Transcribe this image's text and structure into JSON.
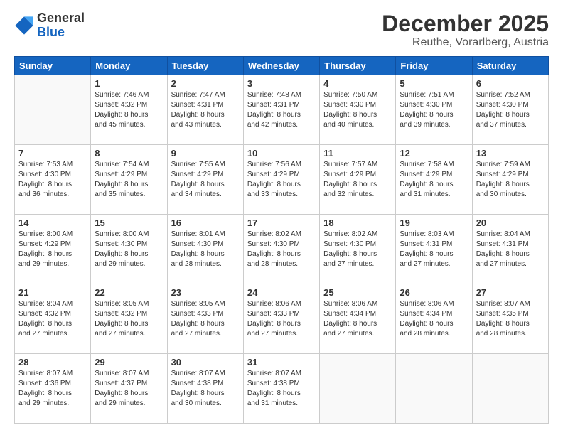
{
  "header": {
    "logo_line1": "General",
    "logo_line2": "Blue",
    "title": "December 2025",
    "subtitle": "Reuthe, Vorarlberg, Austria"
  },
  "days_of_week": [
    "Sunday",
    "Monday",
    "Tuesday",
    "Wednesday",
    "Thursday",
    "Friday",
    "Saturday"
  ],
  "weeks": [
    [
      {
        "day": "",
        "info": ""
      },
      {
        "day": "1",
        "info": "Sunrise: 7:46 AM\nSunset: 4:32 PM\nDaylight: 8 hours\nand 45 minutes."
      },
      {
        "day": "2",
        "info": "Sunrise: 7:47 AM\nSunset: 4:31 PM\nDaylight: 8 hours\nand 43 minutes."
      },
      {
        "day": "3",
        "info": "Sunrise: 7:48 AM\nSunset: 4:31 PM\nDaylight: 8 hours\nand 42 minutes."
      },
      {
        "day": "4",
        "info": "Sunrise: 7:50 AM\nSunset: 4:30 PM\nDaylight: 8 hours\nand 40 minutes."
      },
      {
        "day": "5",
        "info": "Sunrise: 7:51 AM\nSunset: 4:30 PM\nDaylight: 8 hours\nand 39 minutes."
      },
      {
        "day": "6",
        "info": "Sunrise: 7:52 AM\nSunset: 4:30 PM\nDaylight: 8 hours\nand 37 minutes."
      }
    ],
    [
      {
        "day": "7",
        "info": "Sunrise: 7:53 AM\nSunset: 4:30 PM\nDaylight: 8 hours\nand 36 minutes."
      },
      {
        "day": "8",
        "info": "Sunrise: 7:54 AM\nSunset: 4:29 PM\nDaylight: 8 hours\nand 35 minutes."
      },
      {
        "day": "9",
        "info": "Sunrise: 7:55 AM\nSunset: 4:29 PM\nDaylight: 8 hours\nand 34 minutes."
      },
      {
        "day": "10",
        "info": "Sunrise: 7:56 AM\nSunset: 4:29 PM\nDaylight: 8 hours\nand 33 minutes."
      },
      {
        "day": "11",
        "info": "Sunrise: 7:57 AM\nSunset: 4:29 PM\nDaylight: 8 hours\nand 32 minutes."
      },
      {
        "day": "12",
        "info": "Sunrise: 7:58 AM\nSunset: 4:29 PM\nDaylight: 8 hours\nand 31 minutes."
      },
      {
        "day": "13",
        "info": "Sunrise: 7:59 AM\nSunset: 4:29 PM\nDaylight: 8 hours\nand 30 minutes."
      }
    ],
    [
      {
        "day": "14",
        "info": "Sunrise: 8:00 AM\nSunset: 4:29 PM\nDaylight: 8 hours\nand 29 minutes."
      },
      {
        "day": "15",
        "info": "Sunrise: 8:00 AM\nSunset: 4:30 PM\nDaylight: 8 hours\nand 29 minutes."
      },
      {
        "day": "16",
        "info": "Sunrise: 8:01 AM\nSunset: 4:30 PM\nDaylight: 8 hours\nand 28 minutes."
      },
      {
        "day": "17",
        "info": "Sunrise: 8:02 AM\nSunset: 4:30 PM\nDaylight: 8 hours\nand 28 minutes."
      },
      {
        "day": "18",
        "info": "Sunrise: 8:02 AM\nSunset: 4:30 PM\nDaylight: 8 hours\nand 27 minutes."
      },
      {
        "day": "19",
        "info": "Sunrise: 8:03 AM\nSunset: 4:31 PM\nDaylight: 8 hours\nand 27 minutes."
      },
      {
        "day": "20",
        "info": "Sunrise: 8:04 AM\nSunset: 4:31 PM\nDaylight: 8 hours\nand 27 minutes."
      }
    ],
    [
      {
        "day": "21",
        "info": "Sunrise: 8:04 AM\nSunset: 4:32 PM\nDaylight: 8 hours\nand 27 minutes."
      },
      {
        "day": "22",
        "info": "Sunrise: 8:05 AM\nSunset: 4:32 PM\nDaylight: 8 hours\nand 27 minutes."
      },
      {
        "day": "23",
        "info": "Sunrise: 8:05 AM\nSunset: 4:33 PM\nDaylight: 8 hours\nand 27 minutes."
      },
      {
        "day": "24",
        "info": "Sunrise: 8:06 AM\nSunset: 4:33 PM\nDaylight: 8 hours\nand 27 minutes."
      },
      {
        "day": "25",
        "info": "Sunrise: 8:06 AM\nSunset: 4:34 PM\nDaylight: 8 hours\nand 27 minutes."
      },
      {
        "day": "26",
        "info": "Sunrise: 8:06 AM\nSunset: 4:34 PM\nDaylight: 8 hours\nand 28 minutes."
      },
      {
        "day": "27",
        "info": "Sunrise: 8:07 AM\nSunset: 4:35 PM\nDaylight: 8 hours\nand 28 minutes."
      }
    ],
    [
      {
        "day": "28",
        "info": "Sunrise: 8:07 AM\nSunset: 4:36 PM\nDaylight: 8 hours\nand 29 minutes."
      },
      {
        "day": "29",
        "info": "Sunrise: 8:07 AM\nSunset: 4:37 PM\nDaylight: 8 hours\nand 29 minutes."
      },
      {
        "day": "30",
        "info": "Sunrise: 8:07 AM\nSunset: 4:38 PM\nDaylight: 8 hours\nand 30 minutes."
      },
      {
        "day": "31",
        "info": "Sunrise: 8:07 AM\nSunset: 4:38 PM\nDaylight: 8 hours\nand 31 minutes."
      },
      {
        "day": "",
        "info": ""
      },
      {
        "day": "",
        "info": ""
      },
      {
        "day": "",
        "info": ""
      }
    ]
  ]
}
